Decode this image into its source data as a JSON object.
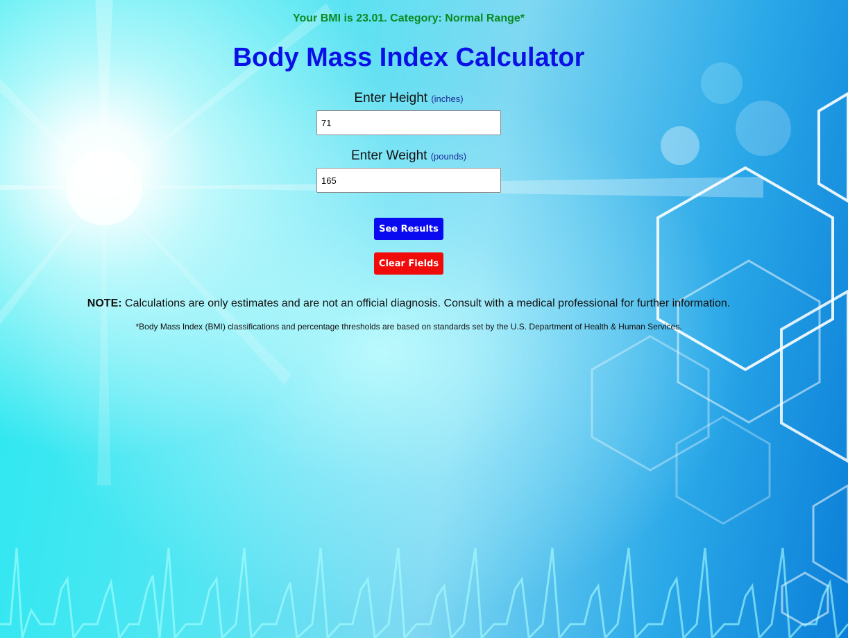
{
  "result": {
    "text": "Your BMI is 23.01. Category: Normal Range*",
    "color": "#0a8a22"
  },
  "title": "Body Mass Index Calculator",
  "height_field": {
    "label": "Enter Height",
    "unit": "(inches)",
    "value": "71"
  },
  "weight_field": {
    "label": "Enter Weight",
    "unit": "(pounds)",
    "value": "165"
  },
  "buttons": {
    "see_results": "See Results",
    "clear_fields": "Clear Fields"
  },
  "note": {
    "prefix": "NOTE:",
    "text": " Calculations are only estimates and are not an official diagnosis. Consult with a medical professional for further information."
  },
  "footnote": "*Body Mass Index (BMI) classifications and percentage thresholds are based on standards set by the U.S. Department of Health & Human Services.",
  "colors": {
    "title": "#0a10e6",
    "see_results_bg": "#0a0af0",
    "clear_fields_bg": "#f00a0a"
  }
}
